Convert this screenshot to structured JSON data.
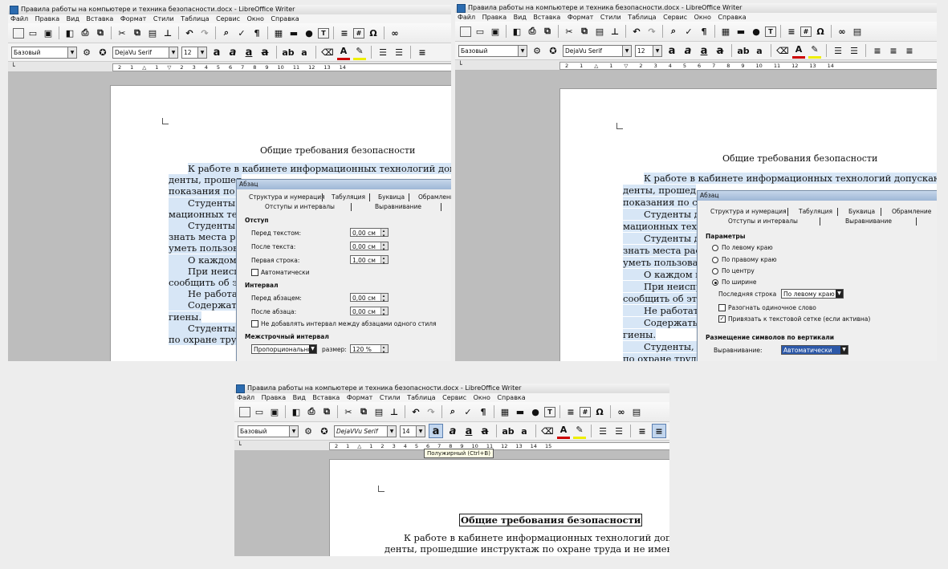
{
  "window": {
    "title": "Правила работы на компьютере и техника безопасности.docx - LibreOffice Writer"
  },
  "menu": [
    "Файл",
    "Правка",
    "Вид",
    "Вставка",
    "Формат",
    "Стили",
    "Таблица",
    "Сервис",
    "Окно",
    "Справка"
  ],
  "toolbar_icons": [
    "new-icon",
    "open-icon",
    "save-icon",
    "export-pdf-icon",
    "print-icon",
    "print-preview-icon",
    "cut-icon",
    "copy-icon",
    "paste-icon",
    "clone-format-icon",
    "undo-icon",
    "redo-icon",
    "find-replace-icon",
    "spellcheck-icon",
    "formatting-marks-icon",
    "table-icon",
    "image-icon",
    "chart-icon",
    "textbox-icon",
    "page-break-icon",
    "field-icon",
    "special-char-icon",
    "hyperlink-icon",
    "footnote-icon"
  ],
  "formatting": {
    "style": "Базовый",
    "font_1": "DejaVu Serif",
    "font_3": "DejaVVu Serif",
    "size_1": "12",
    "size_3": "14",
    "bold_glyph": "a",
    "italic_glyph": "a",
    "underline_glyph": "a",
    "strike_glyph": "a",
    "super_glyph": "ab",
    "sub_glyph": "a"
  },
  "ruler": {
    "numbers": [
      "2",
      "1",
      "1",
      "2",
      "3",
      "4",
      "5",
      "6",
      "7",
      "8",
      "9",
      "10",
      "11",
      "12",
      "13",
      "14",
      "15"
    ]
  },
  "document": {
    "heading": "Общие требования безопасности",
    "paragraph_1_line_1": "К работе в кабинете информационных технологий допускаются",
    "p1_l1_short": "К работе в кабинете информационных технологий допускаю",
    "p1_l1_s3": "К работе в кабинете информационных технологий допускаются с",
    "p1_l2_left": "денты, прошед",
    "p1_l2_s3": "денты, прошедшие инструктаж по охране труда и не имеющие проти",
    "p1_l3_left": "показания по со",
    "p2_l1": "Студенты д",
    "p2_l2": "мационных техн",
    "p3_l1": "Студенты д",
    "p3_l2": "знать места рас",
    "p3_l3": "уметь пользоват",
    "p4_l1": "О каждом н",
    "p5_l1": "При неиспр",
    "p5_l2": "сообщить об это",
    "p6_l1": "Не работат",
    "p7_l1": "Содержать",
    "p7_l2": "гиены.",
    "p8_l1": "Студенты, д",
    "p8_l2": "по охране труда",
    "p8_l2_s2": "по охране труда"
  },
  "dialog_1": {
    "title": "Абзац",
    "tabs_row1": [
      "Структура и нумерация",
      "Табуляция",
      "Буквица",
      "Обрамлени"
    ],
    "tabs_row2": [
      "Отступы и интервалы",
      "Выравнивание"
    ],
    "section_indent": "Отступ",
    "before_text_label": "Перед текстом:",
    "before_text_value": "0,00 см",
    "after_text_label": "После текста:",
    "after_text_value": "0,00 см",
    "first_line_label": "Первая строка:",
    "first_line_value": "1,00 см",
    "auto_label": "Автоматически",
    "section_spacing": "Интервал",
    "before_para_label": "Перед абзацем:",
    "before_para_value": "0,00 см",
    "after_para_label": "После абзаца:",
    "after_para_value": "0,00 см",
    "no_space_label": "Не добавлять интервал между абзацами одного стиля",
    "section_line_spacing": "Межстрочный интервал",
    "line_spacing_value": "Пропорционально",
    "size_label": "размер:",
    "size_value": "120 %"
  },
  "dialog_2": {
    "title": "Абзац",
    "tabs_row1": [
      "Структура и нумерация",
      "Табуляция",
      "Буквица",
      "Обрамление"
    ],
    "tabs_row2": [
      "Отступы и интервалы",
      "Выравнивание"
    ],
    "section_params": "Параметры",
    "left": "По левому краю",
    "right": "По правому краю",
    "center": "По центру",
    "justify": "По ширине",
    "last_line_label": "Последняя строка",
    "last_line_value": "По левому краю",
    "expand_word": "Разогнать одиночное слово",
    "snap_grid": "Привязать к текстовой сетке (если активна)",
    "section_vertical": "Размещение символов по вертикали",
    "align_label": "Выравнивание:",
    "align_value": "Автоматически"
  },
  "tooltip_bold": "Полужирный (Ctrl+B)"
}
